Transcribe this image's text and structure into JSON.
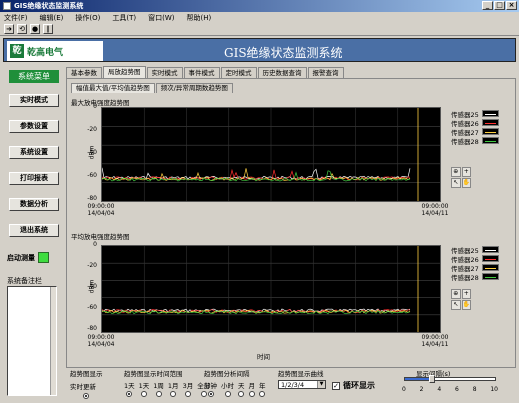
{
  "window": {
    "title": "GIS绝缘状态监测系统"
  },
  "menu": [
    "文件(F)",
    "编辑(E)",
    "操作(O)",
    "工具(T)",
    "窗口(W)",
    "帮助(H)"
  ],
  "header": {
    "company": "乾高电气",
    "logo_mark": "乾",
    "title": "GIS绝缘状态监测系统"
  },
  "sidebar": {
    "heading": "系统菜单",
    "buttons": [
      "实时模式",
      "参数设置",
      "系统设置",
      "打印报表",
      "数据分析",
      "退出系统"
    ],
    "start_label": "启动测量",
    "notes_label": "系统备注栏"
  },
  "tabs": [
    "基本参数",
    "局放趋势图",
    "实时模式",
    "事件模式",
    "定时模式",
    "历史数据查询",
    "报警查询"
  ],
  "active_tab": 1,
  "subtabs": [
    "幅值最大值/平均值趋势图",
    "频次/异常周期数趋势图"
  ],
  "chart1": {
    "title": "最大放电强度趋势图",
    "unit": "dBm",
    "yticks": [
      "0",
      "-20",
      "-40",
      "-60",
      "-80"
    ],
    "xticks": [
      {
        "time": "09:00:00",
        "date": "14/04/04"
      },
      {
        "time": "09:00:00",
        "date": "14/04/11"
      }
    ]
  },
  "chart2": {
    "title": "平均放电强度趋势图",
    "unit": "dBm",
    "yticks": [
      "0",
      "-20",
      "-40",
      "-60",
      "-80"
    ],
    "xticks": [
      {
        "time": "09:00:00",
        "date": "14/04/04"
      },
      {
        "time": "09:00:00",
        "date": "14/04/11"
      }
    ],
    "xlabel": "时间"
  },
  "legend": [
    "传感器25",
    "传感器26",
    "传感器27",
    "传感器28"
  ],
  "series_colors": [
    "#ffffff",
    "#ff3030",
    "#ffd040",
    "#40c840"
  ],
  "bottom": {
    "display_label": "趋势图显示",
    "display_option": "实时更新",
    "range_label": "趋势图显示时间范围",
    "range_options": [
      "1天",
      "1天",
      "1周",
      "1月",
      "3月",
      "全部"
    ],
    "interval_label": "趋势图分析间隔",
    "interval_options": [
      "分钟",
      "小时",
      "天",
      "月",
      "年"
    ],
    "curves_label": "趋势图显示曲线",
    "curves_value": "1/2/3/4",
    "loop_label": "循环显示",
    "loop_checked": true,
    "spacing_label": "显示间隔(s)",
    "spacing_ticks": [
      "0",
      "2",
      "4",
      "6",
      "8",
      "10"
    ],
    "spacing_value": 3
  }
}
